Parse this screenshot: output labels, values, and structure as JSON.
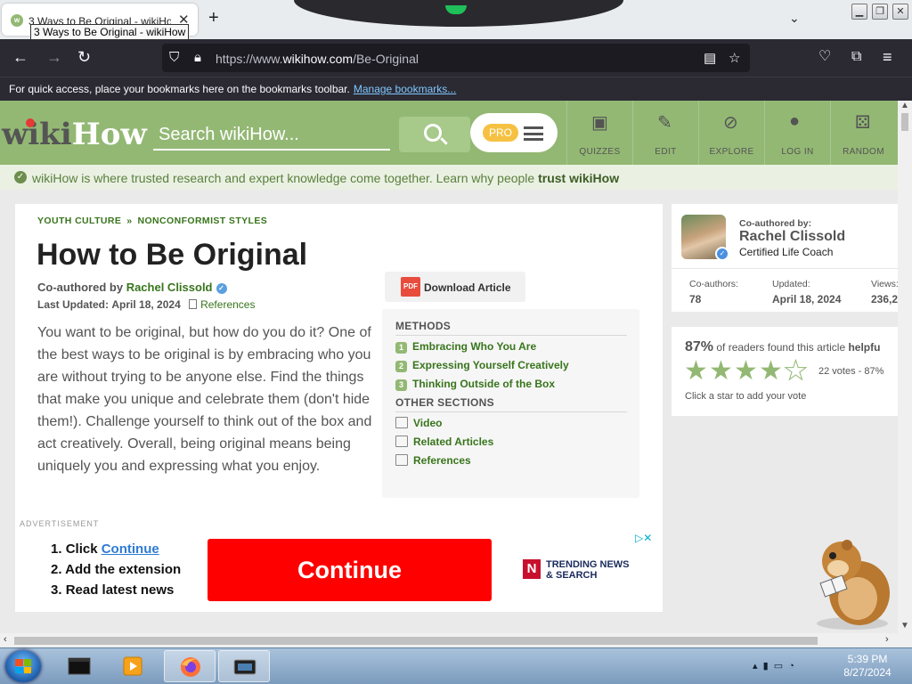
{
  "browser": {
    "tab_title": "3 Ways to Be Original - wikiHow",
    "tab_tooltip": "3 Ways to Be Original - wikiHow",
    "url_prefix": "https://www.",
    "url_domain": "wikihow.com",
    "url_path": "/Be-Original",
    "bookmarks_message": "For quick access, place your bookmarks here on the bookmarks toolbar.",
    "bookmarks_link": "Manage bookmarks..."
  },
  "header": {
    "logo_wiki": "wiki",
    "logo_how": "How",
    "search_placeholder": "Search wikiHow...",
    "pro_badge": "PRO",
    "nav": [
      {
        "label": "QUIZZES",
        "icon": "quiz-icon"
      },
      {
        "label": "EDIT",
        "icon": "pencil-icon"
      },
      {
        "label": "EXPLORE",
        "icon": "compass-icon"
      },
      {
        "label": "LOG IN",
        "icon": "user-icon"
      },
      {
        "label": "RANDOM",
        "icon": "dice-icon"
      }
    ]
  },
  "trust": {
    "text": "wikiHow is where trusted research and expert knowledge come together. Learn why people",
    "bold": "trust wikiHow"
  },
  "article": {
    "breadcrumb": [
      "YOUTH CULTURE",
      "NONCONFORMIST STYLES"
    ],
    "breadcrumb_sep": "»",
    "title": "How to Be Original",
    "coauthored_prefix": "Co-authored by",
    "author": "Rachel Clissold",
    "updated_label": "Last Updated:",
    "updated_date": "April 18, 2024",
    "references_link": "References",
    "intro": "You want to be original, but how do you do it? One of the best ways to be original is by embracing who you are without trying to be anyone else. Find the things that make you unique and celebrate them (don't hide them!). Challenge yourself to think out of the box and act creatively. Overall, being original means being uniquely you and expressing what you enjoy.",
    "download_label": "Download Article",
    "pdf_icon_text": "PDF"
  },
  "toc": {
    "methods_heading": "METHODS",
    "methods": [
      {
        "num": "1",
        "label": "Embracing Who You Are"
      },
      {
        "num": "2",
        "label": "Expressing Yourself Creatively"
      },
      {
        "num": "3",
        "label": "Thinking Outside of the Box"
      }
    ],
    "other_heading": "OTHER SECTIONS",
    "other": [
      {
        "label": "Video",
        "icon": "video-icon"
      },
      {
        "label": "Related Articles",
        "icon": "articles-icon"
      },
      {
        "label": "References",
        "icon": "document-icon"
      }
    ]
  },
  "ad": {
    "label": "ADVERTISEMENT",
    "steps": [
      {
        "num": "1.",
        "text": "Click",
        "link": "Continue"
      },
      {
        "num": "2.",
        "text": "Add the extension"
      },
      {
        "num": "3.",
        "text": "Read latest news"
      }
    ],
    "button": "Continue",
    "brand_line1": "TRENDING NEWS",
    "brand_line2": "& SEARCH",
    "brand_mark": "N"
  },
  "sidebar": {
    "coauthored_label": "Co-authored by:",
    "author_name": "Rachel Clissold",
    "author_role": "Certified Life Coach",
    "stats": [
      {
        "label": "Co-authors:",
        "value": "78"
      },
      {
        "label": "Updated:",
        "value": "April 18, 2024"
      },
      {
        "label": "Views:",
        "value": "236,2"
      }
    ],
    "rating_pct": "87%",
    "rating_text": "of readers found this article",
    "rating_helpful": "helpfu",
    "stars_filled": 4.35,
    "votes": "22 votes - 87%",
    "hint": "Click a star to add your vote"
  },
  "taskbar": {
    "time": "5:39 PM",
    "date": "8/27/2024"
  },
  "colors": {
    "brand_green": "#93b874",
    "link_green": "#38751c",
    "ad_red": "#ff0000",
    "firefox_dark": "#2b2a33"
  }
}
